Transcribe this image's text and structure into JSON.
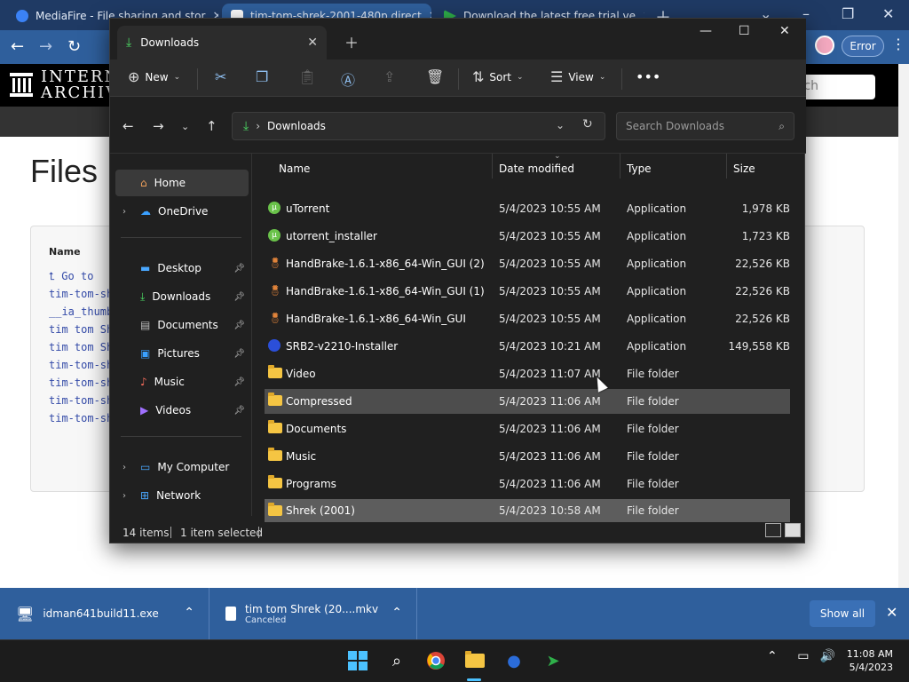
{
  "browser": {
    "tabs": [
      {
        "title": "MediaFire - File sharing and stor",
        "icon": "mediafire-icon",
        "color": "#3b82f6"
      },
      {
        "title": "tim-tom-shrek-2001-480p direct",
        "icon": "archive-icon",
        "color": "#ffffff"
      },
      {
        "title": "Download the latest free trial ve",
        "icon": "idm-icon",
        "color": "#2fb04a"
      }
    ],
    "profile_error": "Error",
    "site": {
      "logo_text_1": "INTERN",
      "logo_text_2": "ARCHIVE",
      "search_placeholder": "rch",
      "page_title": "Files",
      "listing_header": "Name",
      "listing_rows": [
        "⮤ Go to",
        "tim-tom-sh",
        "__ia_thumb",
        "tim tom Sh",
        "tim tom Sh",
        "tim-tom-sh",
        "tim-tom-sh",
        "tim-tom-sh",
        "tim-tom-sh"
      ]
    }
  },
  "downloads_shelf": {
    "items": [
      {
        "name": "idman641build11.exe",
        "sub": ""
      },
      {
        "name": "tim tom Shrek (20....mkv",
        "sub": "Canceled"
      }
    ],
    "show_all": "Show all"
  },
  "explorer": {
    "tab_title": "Downloads",
    "toolbar": {
      "new": "New",
      "sort": "Sort",
      "view": "View"
    },
    "address": {
      "path": "Downloads",
      "search_placeholder": "Search Downloads"
    },
    "columns": {
      "name": "Name",
      "date": "Date modified",
      "type": "Type",
      "size": "Size"
    },
    "nav": [
      {
        "label": "Home",
        "icon": "home-icon",
        "selected": true
      },
      {
        "label": "OneDrive",
        "icon": "onedrive-icon"
      },
      {
        "label": "Desktop",
        "icon": "desktop-icon",
        "pinned": true
      },
      {
        "label": "Downloads",
        "icon": "downloads-icon",
        "pinned": true
      },
      {
        "label": "Documents",
        "icon": "documents-icon",
        "pinned": true
      },
      {
        "label": "Pictures",
        "icon": "pictures-icon",
        "pinned": true
      },
      {
        "label": "Music",
        "icon": "music-icon",
        "pinned": true
      },
      {
        "label": "Videos",
        "icon": "videos-icon",
        "pinned": true
      },
      {
        "label": "My Computer",
        "icon": "computer-icon"
      },
      {
        "label": "Network",
        "icon": "network-icon"
      }
    ],
    "files": [
      {
        "name": "uTorrent",
        "date": "5/4/2023 10:55 AM",
        "type": "Application",
        "size": "1,978 KB",
        "icon": "utorrent-icon"
      },
      {
        "name": "utorrent_installer",
        "date": "5/4/2023 10:55 AM",
        "type": "Application",
        "size": "1,723 KB",
        "icon": "utorrent-icon"
      },
      {
        "name": "HandBrake-1.6.1-x86_64-Win_GUI (2)",
        "date": "5/4/2023 10:55 AM",
        "type": "Application",
        "size": "22,526 KB",
        "icon": "handbrake-icon"
      },
      {
        "name": "HandBrake-1.6.1-x86_64-Win_GUI (1)",
        "date": "5/4/2023 10:55 AM",
        "type": "Application",
        "size": "22,526 KB",
        "icon": "handbrake-icon"
      },
      {
        "name": "HandBrake-1.6.1-x86_64-Win_GUI",
        "date": "5/4/2023 10:55 AM",
        "type": "Application",
        "size": "22,526 KB",
        "icon": "handbrake-icon"
      },
      {
        "name": "SRB2-v2210-Installer",
        "date": "5/4/2023 10:21 AM",
        "type": "Application",
        "size": "149,558 KB",
        "icon": "srb2-icon"
      },
      {
        "name": "Video",
        "date": "5/4/2023 11:07 AM",
        "type": "File folder",
        "size": "",
        "icon": "folder-icon"
      },
      {
        "name": "Compressed",
        "date": "5/4/2023 11:06 AM",
        "type": "File folder",
        "size": "",
        "icon": "folder-icon",
        "hover": true
      },
      {
        "name": "Documents",
        "date": "5/4/2023 11:06 AM",
        "type": "File folder",
        "size": "",
        "icon": "folder-icon"
      },
      {
        "name": "Music",
        "date": "5/4/2023 11:06 AM",
        "type": "File folder",
        "size": "",
        "icon": "folder-icon"
      },
      {
        "name": "Programs",
        "date": "5/4/2023 11:06 AM",
        "type": "File folder",
        "size": "",
        "icon": "folder-icon"
      },
      {
        "name": "Shrek (2001)",
        "date": "5/4/2023 10:58 AM",
        "type": "File folder",
        "size": "",
        "icon": "folder-icon",
        "selected": true
      }
    ],
    "status": {
      "count": "14 items",
      "selection": "1 item selected"
    }
  },
  "taskbar": {
    "time": "11:08 AM",
    "date": "5/4/2023"
  },
  "colors": {
    "chrome_dark": "#1f3a64",
    "chrome_bar": "#2f5f9c",
    "explorer_bg": "#202020",
    "accent": "#4cc2ff"
  }
}
